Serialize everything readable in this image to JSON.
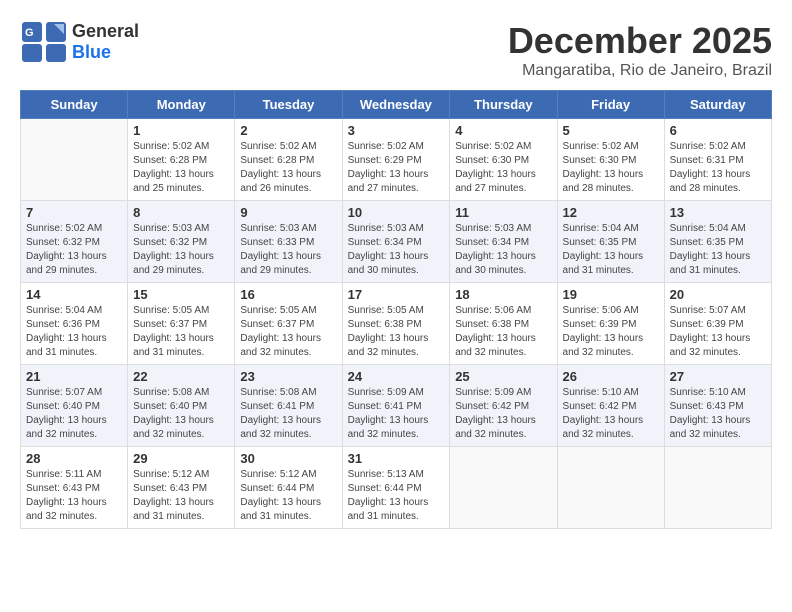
{
  "logo": {
    "general": "General",
    "blue": "Blue"
  },
  "header": {
    "month": "December 2025",
    "location": "Mangaratiba, Rio de Janeiro, Brazil"
  },
  "weekdays": [
    "Sunday",
    "Monday",
    "Tuesday",
    "Wednesday",
    "Thursday",
    "Friday",
    "Saturday"
  ],
  "weeks": [
    [
      {
        "day": "",
        "sunrise": "",
        "sunset": "",
        "daylight": ""
      },
      {
        "day": "1",
        "sunrise": "Sunrise: 5:02 AM",
        "sunset": "Sunset: 6:28 PM",
        "daylight": "Daylight: 13 hours and 25 minutes."
      },
      {
        "day": "2",
        "sunrise": "Sunrise: 5:02 AM",
        "sunset": "Sunset: 6:28 PM",
        "daylight": "Daylight: 13 hours and 26 minutes."
      },
      {
        "day": "3",
        "sunrise": "Sunrise: 5:02 AM",
        "sunset": "Sunset: 6:29 PM",
        "daylight": "Daylight: 13 hours and 27 minutes."
      },
      {
        "day": "4",
        "sunrise": "Sunrise: 5:02 AM",
        "sunset": "Sunset: 6:30 PM",
        "daylight": "Daylight: 13 hours and 27 minutes."
      },
      {
        "day": "5",
        "sunrise": "Sunrise: 5:02 AM",
        "sunset": "Sunset: 6:30 PM",
        "daylight": "Daylight: 13 hours and 28 minutes."
      },
      {
        "day": "6",
        "sunrise": "Sunrise: 5:02 AM",
        "sunset": "Sunset: 6:31 PM",
        "daylight": "Daylight: 13 hours and 28 minutes."
      }
    ],
    [
      {
        "day": "7",
        "sunrise": "Sunrise: 5:02 AM",
        "sunset": "Sunset: 6:32 PM",
        "daylight": "Daylight: 13 hours and 29 minutes."
      },
      {
        "day": "8",
        "sunrise": "Sunrise: 5:03 AM",
        "sunset": "Sunset: 6:32 PM",
        "daylight": "Daylight: 13 hours and 29 minutes."
      },
      {
        "day": "9",
        "sunrise": "Sunrise: 5:03 AM",
        "sunset": "Sunset: 6:33 PM",
        "daylight": "Daylight: 13 hours and 29 minutes."
      },
      {
        "day": "10",
        "sunrise": "Sunrise: 5:03 AM",
        "sunset": "Sunset: 6:34 PM",
        "daylight": "Daylight: 13 hours and 30 minutes."
      },
      {
        "day": "11",
        "sunrise": "Sunrise: 5:03 AM",
        "sunset": "Sunset: 6:34 PM",
        "daylight": "Daylight: 13 hours and 30 minutes."
      },
      {
        "day": "12",
        "sunrise": "Sunrise: 5:04 AM",
        "sunset": "Sunset: 6:35 PM",
        "daylight": "Daylight: 13 hours and 31 minutes."
      },
      {
        "day": "13",
        "sunrise": "Sunrise: 5:04 AM",
        "sunset": "Sunset: 6:35 PM",
        "daylight": "Daylight: 13 hours and 31 minutes."
      }
    ],
    [
      {
        "day": "14",
        "sunrise": "Sunrise: 5:04 AM",
        "sunset": "Sunset: 6:36 PM",
        "daylight": "Daylight: 13 hours and 31 minutes."
      },
      {
        "day": "15",
        "sunrise": "Sunrise: 5:05 AM",
        "sunset": "Sunset: 6:37 PM",
        "daylight": "Daylight: 13 hours and 31 minutes."
      },
      {
        "day": "16",
        "sunrise": "Sunrise: 5:05 AM",
        "sunset": "Sunset: 6:37 PM",
        "daylight": "Daylight: 13 hours and 32 minutes."
      },
      {
        "day": "17",
        "sunrise": "Sunrise: 5:05 AM",
        "sunset": "Sunset: 6:38 PM",
        "daylight": "Daylight: 13 hours and 32 minutes."
      },
      {
        "day": "18",
        "sunrise": "Sunrise: 5:06 AM",
        "sunset": "Sunset: 6:38 PM",
        "daylight": "Daylight: 13 hours and 32 minutes."
      },
      {
        "day": "19",
        "sunrise": "Sunrise: 5:06 AM",
        "sunset": "Sunset: 6:39 PM",
        "daylight": "Daylight: 13 hours and 32 minutes."
      },
      {
        "day": "20",
        "sunrise": "Sunrise: 5:07 AM",
        "sunset": "Sunset: 6:39 PM",
        "daylight": "Daylight: 13 hours and 32 minutes."
      }
    ],
    [
      {
        "day": "21",
        "sunrise": "Sunrise: 5:07 AM",
        "sunset": "Sunset: 6:40 PM",
        "daylight": "Daylight: 13 hours and 32 minutes."
      },
      {
        "day": "22",
        "sunrise": "Sunrise: 5:08 AM",
        "sunset": "Sunset: 6:40 PM",
        "daylight": "Daylight: 13 hours and 32 minutes."
      },
      {
        "day": "23",
        "sunrise": "Sunrise: 5:08 AM",
        "sunset": "Sunset: 6:41 PM",
        "daylight": "Daylight: 13 hours and 32 minutes."
      },
      {
        "day": "24",
        "sunrise": "Sunrise: 5:09 AM",
        "sunset": "Sunset: 6:41 PM",
        "daylight": "Daylight: 13 hours and 32 minutes."
      },
      {
        "day": "25",
        "sunrise": "Sunrise: 5:09 AM",
        "sunset": "Sunset: 6:42 PM",
        "daylight": "Daylight: 13 hours and 32 minutes."
      },
      {
        "day": "26",
        "sunrise": "Sunrise: 5:10 AM",
        "sunset": "Sunset: 6:42 PM",
        "daylight": "Daylight: 13 hours and 32 minutes."
      },
      {
        "day": "27",
        "sunrise": "Sunrise: 5:10 AM",
        "sunset": "Sunset: 6:43 PM",
        "daylight": "Daylight: 13 hours and 32 minutes."
      }
    ],
    [
      {
        "day": "28",
        "sunrise": "Sunrise: 5:11 AM",
        "sunset": "Sunset: 6:43 PM",
        "daylight": "Daylight: 13 hours and 32 minutes."
      },
      {
        "day": "29",
        "sunrise": "Sunrise: 5:12 AM",
        "sunset": "Sunset: 6:43 PM",
        "daylight": "Daylight: 13 hours and 31 minutes."
      },
      {
        "day": "30",
        "sunrise": "Sunrise: 5:12 AM",
        "sunset": "Sunset: 6:44 PM",
        "daylight": "Daylight: 13 hours and 31 minutes."
      },
      {
        "day": "31",
        "sunrise": "Sunrise: 5:13 AM",
        "sunset": "Sunset: 6:44 PM",
        "daylight": "Daylight: 13 hours and 31 minutes."
      },
      {
        "day": "",
        "sunrise": "",
        "sunset": "",
        "daylight": ""
      },
      {
        "day": "",
        "sunrise": "",
        "sunset": "",
        "daylight": ""
      },
      {
        "day": "",
        "sunrise": "",
        "sunset": "",
        "daylight": ""
      }
    ]
  ]
}
